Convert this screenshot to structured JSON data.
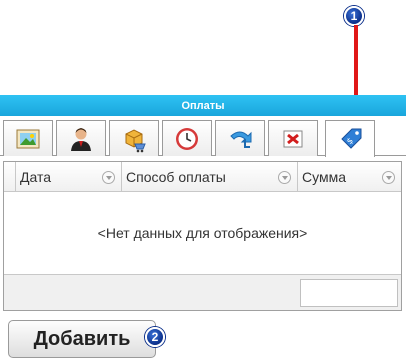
{
  "callouts": {
    "badge1": "1",
    "badge2": "2"
  },
  "panel": {
    "title": "Оплаты"
  },
  "tabs": [
    {
      "icon": "photo-icon"
    },
    {
      "icon": "person-icon"
    },
    {
      "icon": "box-cart-icon"
    },
    {
      "icon": "clock-icon"
    },
    {
      "icon": "redo-arrow-icon"
    },
    {
      "icon": "delete-icon"
    },
    {
      "icon": "price-tag-icon",
      "active": true
    }
  ],
  "grid": {
    "columns": [
      "Дата",
      "Способ оплаты",
      "Сумма"
    ],
    "empty_text": "<Нет данных для отображения>"
  },
  "actions": {
    "add_label": "Добавить"
  },
  "colors": {
    "header_bar": "#1fb1e6",
    "arrow": "#e01818",
    "badge": "#0b2f8a"
  }
}
